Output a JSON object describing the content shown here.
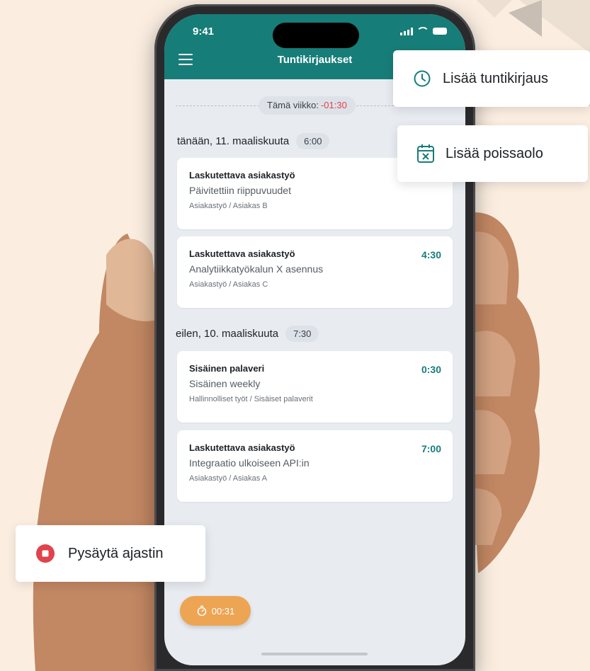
{
  "status_bar": {
    "time": "9:41"
  },
  "app_bar": {
    "title": "Tuntikirjaukset"
  },
  "week_summary": {
    "label": "Tämä viikko:",
    "value": "-01:30"
  },
  "days": [
    {
      "header": "tänään, 11. maaliskuuta",
      "total": "6:00",
      "entries": [
        {
          "title": "Laskutettava asiakastyö",
          "description": "Päivitettiin riippuvuudet",
          "path": "Asiakastyö / Asiakas B",
          "time": ""
        },
        {
          "title": "Laskutettava asiakastyö",
          "description": "Analytiikkatyökalun X asennus",
          "path": "Asiakastyö / Asiakas C",
          "time": "4:30"
        }
      ]
    },
    {
      "header": "eilen, 10. maaliskuuta",
      "total": "7:30",
      "entries": [
        {
          "title": "Sisäinen palaveri",
          "description": "Sisäinen weekly",
          "path": "Hallinnolliset työt / Sisäiset palaverit",
          "time": "0:30"
        },
        {
          "title": "Laskutettava asiakastyö",
          "description": "Integraatio ulkoiseen API:in",
          "path": "Asiakastyö / Asiakas A",
          "time": "7:00"
        }
      ]
    }
  ],
  "timer": {
    "value": "00:31",
    "icon": "stopwatch-icon"
  },
  "popups": {
    "add_hour_entry": {
      "label": "Lisää tuntikirjaus",
      "icon": "clock-icon"
    },
    "add_absence": {
      "label": "Lisää poissaolo",
      "icon": "calendar-x-icon"
    },
    "stop_timer": {
      "label": "Pysäytä ajastin",
      "icon": "stop-icon"
    }
  },
  "colors": {
    "accent": "#177d78",
    "timer": "#eda554",
    "negative": "#e0434c",
    "background": "#fbeee1",
    "stop": "#e0434c"
  }
}
